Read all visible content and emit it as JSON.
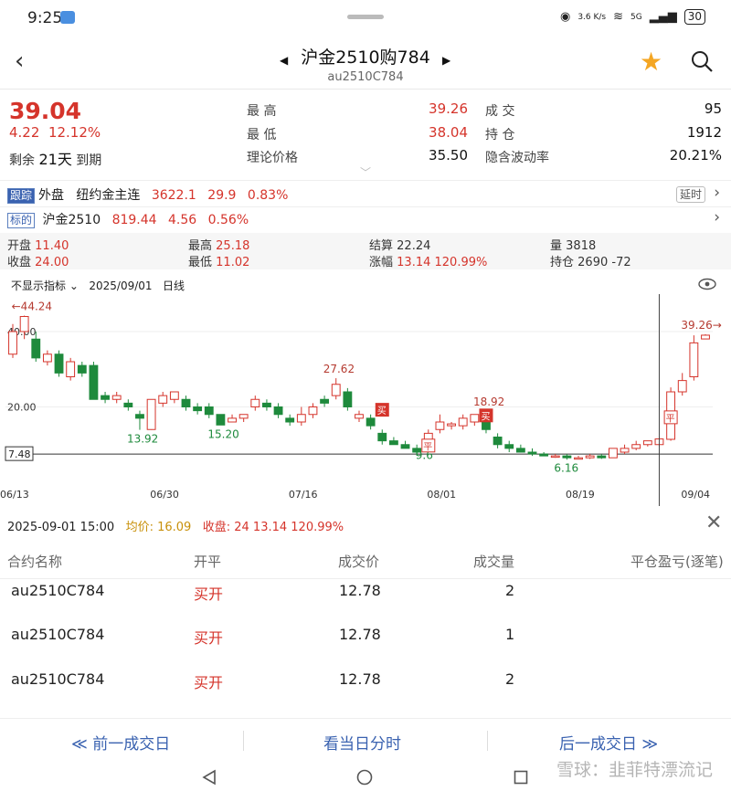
{
  "status": {
    "time": "9:25",
    "net_speed": "3.6 K/s",
    "signal": "5G",
    "battery": "30"
  },
  "header": {
    "title": "沪金2510购784",
    "subtitle": "au2510C784",
    "prev": "◀",
    "next": "▶"
  },
  "quote": {
    "last": "39.04",
    "change": "4.22",
    "change_pct": "12.12%",
    "expiry_prefix": "剩余",
    "expiry_days": "21天",
    "expiry_suffix": "到期",
    "high_label": "最 高",
    "high": "39.26",
    "low_label": "最 低",
    "low": "38.04",
    "theo_label": "理论价格",
    "theo": "35.50",
    "vol_label": "成 交",
    "vol": "95",
    "oi_label": "持 仓",
    "oi": "1912",
    "iv_label": "隐含波动率",
    "iv": "20.21%"
  },
  "tracking": {
    "tag": "跟踪",
    "name": "外盘",
    "ref_name": "纽约金主连",
    "ref_price": "3622.1",
    "ref_change": "29.9",
    "ref_pct": "0.83%",
    "delay": "延时"
  },
  "underlying": {
    "tag": "标的",
    "name": "沪金2510",
    "price": "819.44",
    "change": "4.56",
    "pct": "0.56%"
  },
  "stats": {
    "open_label": "开盘",
    "open": "11.40",
    "close_label": "收盘",
    "close": "24.00",
    "high_label": "最高",
    "high": "25.18",
    "low_label": "最低",
    "low": "11.02",
    "settle_label": "结算",
    "settle": "22.24",
    "chg_label": "涨幅",
    "chg": "13.14 120.99%",
    "vol_label": "量",
    "vol": "3818",
    "oi_label": "持仓",
    "oi": "2690 -72"
  },
  "chart_toolbar": {
    "indicator": "不显示指标",
    "date": "2025/09/01",
    "period": "日线"
  },
  "chart_data": {
    "type": "candlestick",
    "ylim": [
      0,
      48
    ],
    "y_ticks": [
      "40.00",
      "20.00"
    ],
    "ref_line": "7.48",
    "ref_line_value": 7.48,
    "x_ticks": [
      "06/13",
      "06/30",
      "07/16",
      "08/01",
      "08/19",
      "09/04"
    ],
    "annotations": [
      {
        "text": "←44.24",
        "value": 44.24
      },
      {
        "text": "13.92",
        "value": 13.92
      },
      {
        "text": "15.20",
        "value": 15.2
      },
      {
        "text": "27.62",
        "value": 27.62
      },
      {
        "text": "18.92",
        "value": 18.92
      },
      {
        "text": "9.6",
        "value": 9.6
      },
      {
        "text": "6.16",
        "value": 6.16
      },
      {
        "text": "39.26→",
        "value": 39.26
      }
    ],
    "markers": [
      "买",
      "平",
      "买",
      "平"
    ],
    "candles": [
      {
        "o": 34,
        "c": 40,
        "h": 42,
        "l": 33
      },
      {
        "o": 40,
        "c": 44,
        "h": 44.24,
        "l": 38
      },
      {
        "o": 38,
        "c": 33,
        "h": 40,
        "l": 32
      },
      {
        "o": 32,
        "c": 34,
        "h": 35,
        "l": 31
      },
      {
        "o": 34,
        "c": 29,
        "h": 35,
        "l": 28
      },
      {
        "o": 28,
        "c": 32,
        "h": 33,
        "l": 27
      },
      {
        "o": 31,
        "c": 29,
        "h": 32,
        "l": 28
      },
      {
        "o": 31,
        "c": 22,
        "h": 32,
        "l": 22
      },
      {
        "o": 23,
        "c": 22,
        "h": 24,
        "l": 21
      },
      {
        "o": 22,
        "c": 23,
        "h": 24,
        "l": 21
      },
      {
        "o": 21,
        "c": 20,
        "h": 22,
        "l": 19
      },
      {
        "o": 18,
        "c": 17,
        "h": 19,
        "l": 13.92
      },
      {
        "o": 14,
        "c": 22,
        "h": 22,
        "l": 13.92
      },
      {
        "o": 21,
        "c": 23,
        "h": 24,
        "l": 20
      },
      {
        "o": 22,
        "c": 24,
        "h": 24,
        "l": 21
      },
      {
        "o": 22,
        "c": 20,
        "h": 23,
        "l": 19
      },
      {
        "o": 20,
        "c": 19,
        "h": 21,
        "l": 18
      },
      {
        "o": 20,
        "c": 18,
        "h": 21,
        "l": 17
      },
      {
        "o": 18,
        "c": 15.2,
        "h": 18,
        "l": 15.2
      },
      {
        "o": 16,
        "c": 17,
        "h": 18,
        "l": 16
      },
      {
        "o": 17,
        "c": 18,
        "h": 18,
        "l": 16
      },
      {
        "o": 20,
        "c": 22,
        "h": 23,
        "l": 19
      },
      {
        "o": 21,
        "c": 20,
        "h": 22,
        "l": 19
      },
      {
        "o": 20,
        "c": 18,
        "h": 21,
        "l": 17
      },
      {
        "o": 17,
        "c": 16,
        "h": 18,
        "l": 15
      },
      {
        "o": 16,
        "c": 18,
        "h": 20,
        "l": 15
      },
      {
        "o": 18,
        "c": 20,
        "h": 21,
        "l": 17
      },
      {
        "o": 22,
        "c": 21,
        "h": 23,
        "l": 20
      },
      {
        "o": 23,
        "c": 26,
        "h": 27.62,
        "l": 22
      },
      {
        "o": 24,
        "c": 20,
        "h": 25,
        "l": 19
      },
      {
        "o": 17,
        "c": 18,
        "h": 19,
        "l": 16
      },
      {
        "o": 17,
        "c": 15,
        "h": 18,
        "l": 14
      },
      {
        "o": 13,
        "c": 11,
        "h": 14,
        "l": 10
      },
      {
        "o": 11,
        "c": 10,
        "h": 12,
        "l": 10
      },
      {
        "o": 10,
        "c": 9,
        "h": 11,
        "l": 9
      },
      {
        "o": 9,
        "c": 8,
        "h": 10,
        "l": 7
      },
      {
        "o": 10,
        "c": 13,
        "h": 14,
        "l": 9.6
      },
      {
        "o": 14,
        "c": 16,
        "h": 18,
        "l": 13
      },
      {
        "o": 15,
        "c": 15.5,
        "h": 16,
        "l": 14
      },
      {
        "o": 15,
        "c": 17,
        "h": 18,
        "l": 14
      },
      {
        "o": 16,
        "c": 18,
        "h": 18,
        "l": 15
      },
      {
        "o": 18,
        "c": 14,
        "h": 18.92,
        "l": 13
      },
      {
        "o": 12,
        "c": 10,
        "h": 13,
        "l": 9
      },
      {
        "o": 10,
        "c": 9,
        "h": 11,
        "l": 8
      },
      {
        "o": 9,
        "c": 8,
        "h": 10,
        "l": 8
      },
      {
        "o": 8,
        "c": 7.5,
        "h": 9,
        "l": 7
      },
      {
        "o": 7.5,
        "c": 7,
        "h": 8,
        "l": 7
      },
      {
        "o": 7,
        "c": 7,
        "h": 7.5,
        "l": 6.5
      },
      {
        "o": 7,
        "c": 6.5,
        "h": 7.5,
        "l": 6
      },
      {
        "o": 6.5,
        "c": 6.5,
        "h": 7,
        "l": 6.16
      },
      {
        "o": 6.5,
        "c": 7,
        "h": 7.5,
        "l": 6.2
      },
      {
        "o": 7,
        "c": 6.5,
        "h": 7.5,
        "l": 6.2
      },
      {
        "o": 6.5,
        "c": 9,
        "h": 9,
        "l": 6.5
      },
      {
        "o": 8,
        "c": 9,
        "h": 10,
        "l": 7.5
      },
      {
        "o": 9,
        "c": 10,
        "h": 11,
        "l": 8.5
      },
      {
        "o": 10,
        "c": 11,
        "h": 11,
        "l": 9.5
      },
      {
        "o": 10,
        "c": 11.5,
        "h": 12,
        "l": 9.5
      },
      {
        "o": 11.4,
        "c": 24,
        "h": 25.18,
        "l": 11.02
      },
      {
        "o": 24,
        "c": 27,
        "h": 29,
        "l": 23
      },
      {
        "o": 28,
        "c": 37,
        "h": 39,
        "l": 27
      },
      {
        "o": 38.04,
        "c": 39.04,
        "h": 39.26,
        "l": 38.04
      }
    ]
  },
  "trade_info": {
    "datetime": "2025-09-01  15:00",
    "avg_label": "均价:",
    "avg": "16.09",
    "close_label": "收盘:",
    "close": "24 13.14 120.99%"
  },
  "trade_table": {
    "headers": [
      "合约名称",
      "开平",
      "成交价",
      "成交量",
      "平仓盈亏(逐笔)"
    ],
    "rows": [
      [
        "au2510C784",
        "买开",
        "12.78",
        "2"
      ],
      [
        "au2510C784",
        "买开",
        "12.78",
        "1"
      ],
      [
        "au2510C784",
        "买开",
        "12.78",
        "2"
      ]
    ]
  },
  "bottom": {
    "prev_day": "≪ 前一成交日",
    "today": "看当日分时",
    "next_day": "后一成交日 ≫"
  },
  "watermark": "雪球：韭菲特漂流记",
  "colors": {
    "up": "#d5342b",
    "down": "#1e8a3c",
    "accent": "#3a62b0",
    "star": "#f4a623"
  }
}
